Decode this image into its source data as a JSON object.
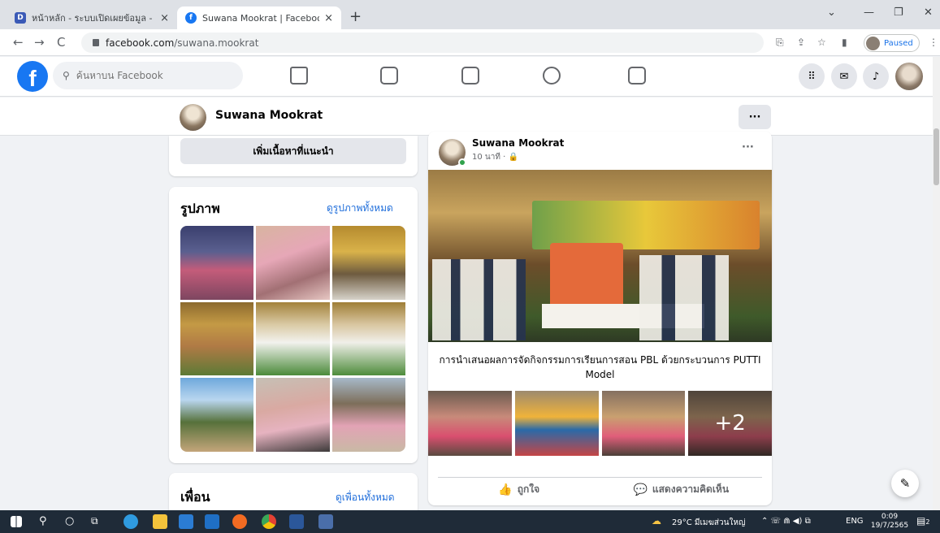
{
  "browser": {
    "tabs": [
      {
        "title": "หน้าหลัก - ระบบเปิดเผยข้อมูล - DEEP",
        "favicon": "deep-favicon",
        "active": false
      },
      {
        "title": "Suwana Mookrat | Facebook",
        "favicon": "facebook-favicon",
        "active": true
      }
    ],
    "url_host": "facebook.com",
    "url_path": "/suwana.mookrat",
    "profile_status": "Paused",
    "new_tab_symbol": "+",
    "close_symbol": "×"
  },
  "facebook": {
    "search_placeholder": "ค้นหาบน Facebook",
    "logo_letter": "f",
    "profile_name": "Suwana Mookrat",
    "more_symbol": "···"
  },
  "left": {
    "suggest_button": "เพิ่มเนื้อหาที่แนะนำ",
    "photos_title": "รูปภาพ",
    "photos_link": "ดูรูปภาพทั้งหมด",
    "friends_title": "เพื่อน",
    "friends_link": "ดูเพื่อนทั้งหมด"
  },
  "post": {
    "author": "Suwana Mookrat",
    "time": "10 นาที · 🔒",
    "caption": "การนำเสนอผลการจัดกิจกรรมการเรียนการสอน PBL ด้วยกระบวนการ PUTTI Model",
    "more_photos": "+2",
    "like_label": "ถูกใจ",
    "comment_label": "แสดงความคิดเห็น"
  },
  "taskbar": {
    "weather": "29°C มีเมฆส่วนใหญ่",
    "language": "ENG",
    "time": "0:09",
    "date": "19/7/2565",
    "notif_count": "2"
  },
  "colors": {
    "facebook_blue": "#1877f2",
    "link_blue": "#216fdb",
    "online_green": "#31a24c"
  }
}
